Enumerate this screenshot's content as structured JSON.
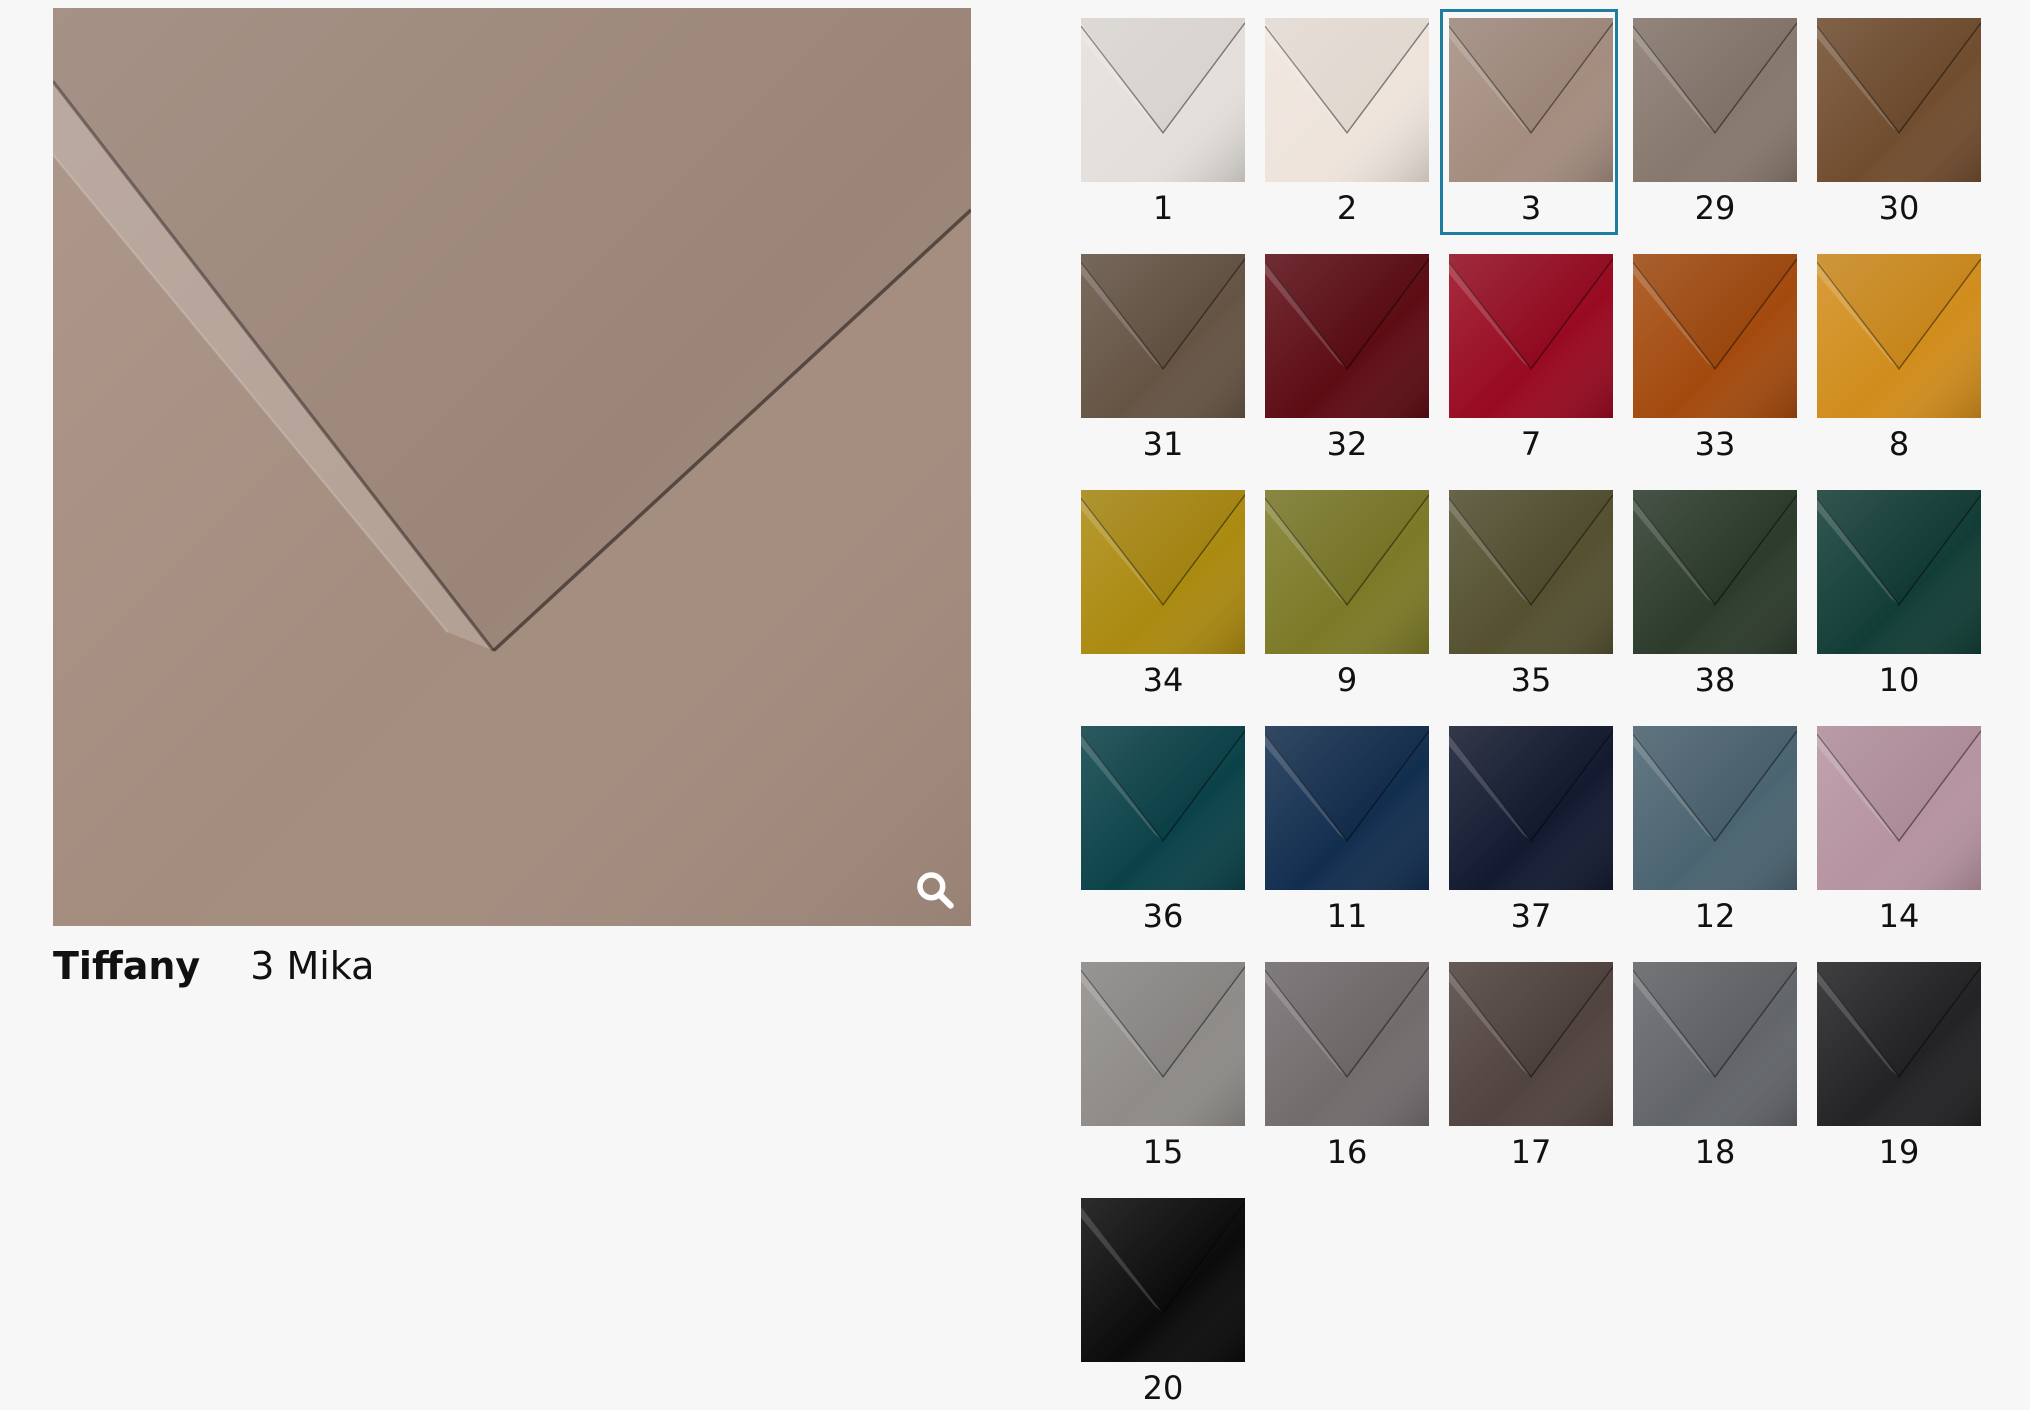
{
  "product": {
    "name": "Tiffany",
    "selected_color_label": "3 Mika",
    "selected_color_hex": "#a48d7f"
  },
  "main_image": {
    "zoom_icon": "search-icon"
  },
  "accent_color": "#1f7ea0",
  "swatches": [
    {
      "label": "1",
      "color": "#e4dfdb",
      "selected": false
    },
    {
      "label": "2",
      "color": "#eee4dc",
      "selected": false
    },
    {
      "label": "3",
      "color": "#a48d7f",
      "selected": true
    },
    {
      "label": "29",
      "color": "#87786d",
      "selected": false
    },
    {
      "label": "30",
      "color": "#714d2f",
      "selected": false
    },
    {
      "label": "31",
      "color": "#655444",
      "selected": false
    },
    {
      "label": "32",
      "color": "#5d0c14",
      "selected": false
    },
    {
      "label": "7",
      "color": "#980a20",
      "selected": false
    },
    {
      "label": "33",
      "color": "#a34a0e",
      "selected": false
    },
    {
      "label": "8",
      "color": "#d18d1c",
      "selected": false
    },
    {
      "label": "34",
      "color": "#ab8a10",
      "selected": false
    },
    {
      "label": "9",
      "color": "#7c7a27",
      "selected": false
    },
    {
      "label": "35",
      "color": "#545030",
      "selected": false
    },
    {
      "label": "38",
      "color": "#2c3b2c",
      "selected": false
    },
    {
      "label": "10",
      "color": "#123d36",
      "selected": false
    },
    {
      "label": "36",
      "color": "#0b4249",
      "selected": false
    },
    {
      "label": "11",
      "color": "#122e4f",
      "selected": false
    },
    {
      "label": "37",
      "color": "#131a30",
      "selected": false
    },
    {
      "label": "12",
      "color": "#4b6471",
      "selected": false
    },
    {
      "label": "14",
      "color": "#b693a1",
      "selected": false
    },
    {
      "label": "15",
      "color": "#8e8b88",
      "selected": false
    },
    {
      "label": "16",
      "color": "#726c6d",
      "selected": false
    },
    {
      "label": "17",
      "color": "#51433f",
      "selected": false
    },
    {
      "label": "18",
      "color": "#626569",
      "selected": false
    },
    {
      "label": "19",
      "color": "#232224",
      "selected": false
    },
    {
      "label": "20",
      "color": "#0b0b0b",
      "selected": false
    }
  ]
}
